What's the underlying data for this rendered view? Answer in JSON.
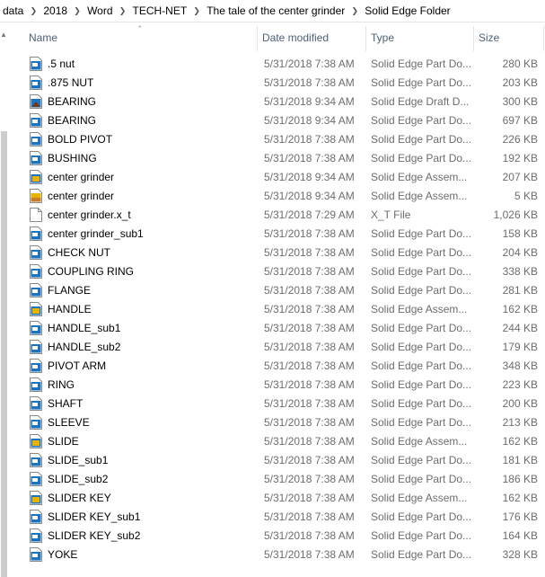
{
  "breadcrumb": [
    "data",
    "2018",
    "Word",
    "TECH-NET",
    "The tale of the center grinder",
    "Solid Edge Folder"
  ],
  "columns": {
    "name": "Name",
    "date": "Date modified",
    "type": "Type",
    "size": "Size"
  },
  "files": [
    {
      "name": ".5 nut",
      "date": "5/31/2018 7:38 AM",
      "type": "Solid Edge Part Do...",
      "size": "280 KB",
      "icon": "part-icon"
    },
    {
      "name": ".875 NUT",
      "date": "5/31/2018 7:38 AM",
      "type": "Solid Edge Part Do...",
      "size": "203 KB",
      "icon": "part-icon"
    },
    {
      "name": "BEARING",
      "date": "5/31/2018 9:34 AM",
      "type": "Solid Edge Draft D...",
      "size": "300 KB",
      "icon": "draft-icon"
    },
    {
      "name": "BEARING",
      "date": "5/31/2018 9:34 AM",
      "type": "Solid Edge Part Do...",
      "size": "697 KB",
      "icon": "part-icon"
    },
    {
      "name": "BOLD PIVOT",
      "date": "5/31/2018 7:38 AM",
      "type": "Solid Edge Part Do...",
      "size": "226 KB",
      "icon": "part-icon"
    },
    {
      "name": "BUSHING",
      "date": "5/31/2018 7:38 AM",
      "type": "Solid Edge Part Do...",
      "size": "192 KB",
      "icon": "part-icon"
    },
    {
      "name": "center grinder",
      "date": "5/31/2018 9:34 AM",
      "type": "Solid Edge Assem...",
      "size": "207 KB",
      "icon": "assembly-icon"
    },
    {
      "name": "center grinder",
      "date": "5/31/2018 9:34 AM",
      "type": "Solid Edge Assem...",
      "size": "5 KB",
      "icon": "assembly-config-icon"
    },
    {
      "name": "center grinder.x_t",
      "date": "5/31/2018 7:29 AM",
      "type": "X_T File",
      "size": "1,026 KB",
      "icon": "blank-file-icon"
    },
    {
      "name": "center grinder_sub1",
      "date": "5/31/2018 7:38 AM",
      "type": "Solid Edge Part Do...",
      "size": "158 KB",
      "icon": "part-icon"
    },
    {
      "name": "CHECK NUT",
      "date": "5/31/2018 7:38 AM",
      "type": "Solid Edge Part Do...",
      "size": "204 KB",
      "icon": "part-icon"
    },
    {
      "name": "COUPLING RING",
      "date": "5/31/2018 7:38 AM",
      "type": "Solid Edge Part Do...",
      "size": "338 KB",
      "icon": "part-icon"
    },
    {
      "name": "FLANGE",
      "date": "5/31/2018 7:38 AM",
      "type": "Solid Edge Part Do...",
      "size": "281 KB",
      "icon": "part-icon"
    },
    {
      "name": "HANDLE",
      "date": "5/31/2018 7:38 AM",
      "type": "Solid Edge Assem...",
      "size": "162 KB",
      "icon": "assembly-icon"
    },
    {
      "name": "HANDLE_sub1",
      "date": "5/31/2018 7:38 AM",
      "type": "Solid Edge Part Do...",
      "size": "244 KB",
      "icon": "part-icon"
    },
    {
      "name": "HANDLE_sub2",
      "date": "5/31/2018 7:38 AM",
      "type": "Solid Edge Part Do...",
      "size": "179 KB",
      "icon": "part-icon"
    },
    {
      "name": "PIVOT ARM",
      "date": "5/31/2018 7:38 AM",
      "type": "Solid Edge Part Do...",
      "size": "348 KB",
      "icon": "part-icon"
    },
    {
      "name": "RING",
      "date": "5/31/2018 7:38 AM",
      "type": "Solid Edge Part Do...",
      "size": "223 KB",
      "icon": "part-icon"
    },
    {
      "name": "SHAFT",
      "date": "5/31/2018 7:38 AM",
      "type": "Solid Edge Part Do...",
      "size": "200 KB",
      "icon": "part-icon"
    },
    {
      "name": "SLEEVE",
      "date": "5/31/2018 7:38 AM",
      "type": "Solid Edge Part Do...",
      "size": "213 KB",
      "icon": "part-icon"
    },
    {
      "name": "SLIDE",
      "date": "5/31/2018 7:38 AM",
      "type": "Solid Edge Assem...",
      "size": "162 KB",
      "icon": "assembly-icon"
    },
    {
      "name": "SLIDE_sub1",
      "date": "5/31/2018 7:38 AM",
      "type": "Solid Edge Part Do...",
      "size": "181 KB",
      "icon": "part-icon"
    },
    {
      "name": "SLIDE_sub2",
      "date": "5/31/2018 7:38 AM",
      "type": "Solid Edge Part Do...",
      "size": "186 KB",
      "icon": "part-icon"
    },
    {
      "name": "SLIDER KEY",
      "date": "5/31/2018 7:38 AM",
      "type": "Solid Edge Assem...",
      "size": "162 KB",
      "icon": "assembly-icon"
    },
    {
      "name": "SLIDER KEY_sub1",
      "date": "5/31/2018 7:38 AM",
      "type": "Solid Edge Part Do...",
      "size": "176 KB",
      "icon": "part-icon"
    },
    {
      "name": "SLIDER KEY_sub2",
      "date": "5/31/2018 7:38 AM",
      "type": "Solid Edge Part Do...",
      "size": "164 KB",
      "icon": "part-icon"
    },
    {
      "name": "YOKE",
      "date": "5/31/2018 7:38 AM",
      "type": "Solid Edge Part Do...",
      "size": "328 KB",
      "icon": "part-icon"
    }
  ],
  "colors": {
    "header_text": "#4c607a",
    "secondary_text": "#6d6d6d",
    "part_blue": "#1e73be",
    "assembly_yellow": "#e8b400"
  }
}
